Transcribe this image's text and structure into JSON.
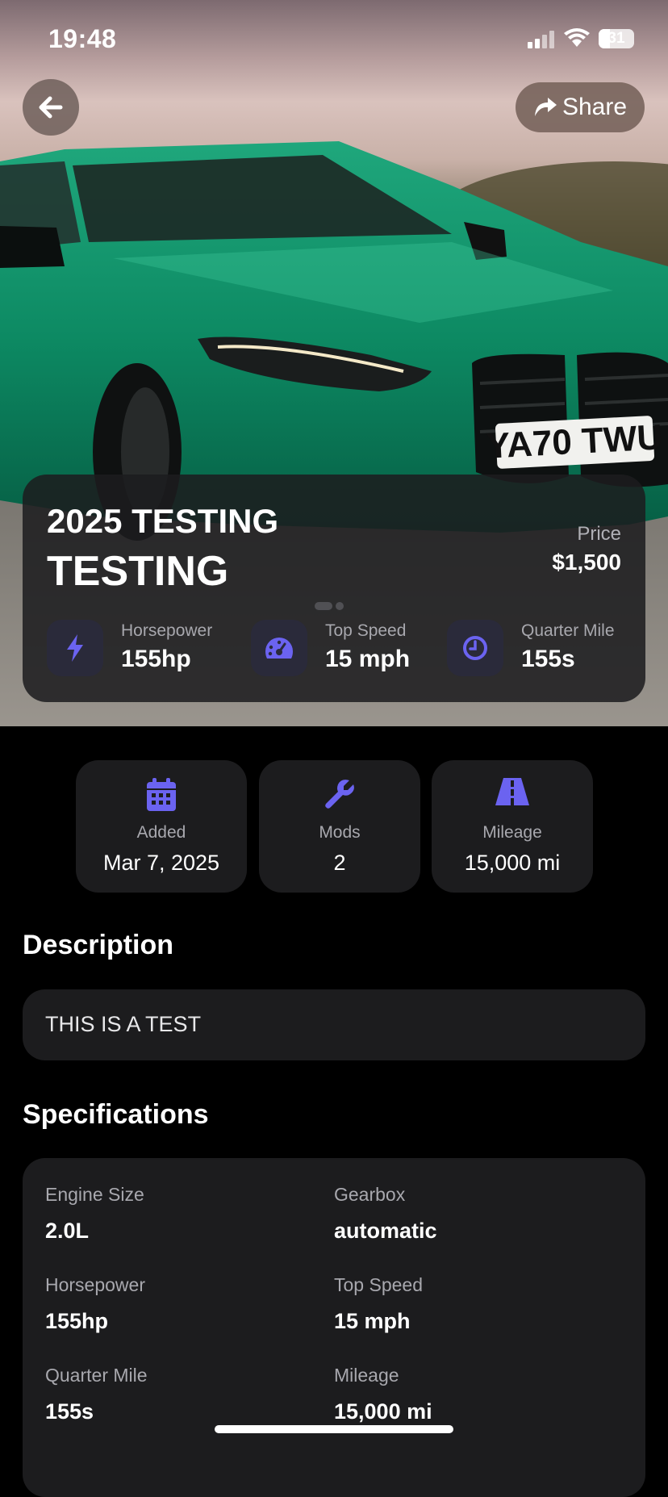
{
  "status_bar": {
    "time": "19:48",
    "battery": "31"
  },
  "header": {
    "share_label": "Share"
  },
  "car": {
    "year_title": "2025 TESTING",
    "model_title": "TESTING",
    "price_label": "Price",
    "price_value": "$1,500",
    "stats": [
      {
        "label": "Horsepower",
        "value": "155hp",
        "icon": "lightning-icon"
      },
      {
        "label": "Top Speed",
        "value": "15 mph",
        "icon": "speedometer-icon"
      },
      {
        "label": "Quarter Mile",
        "value": "155s",
        "icon": "clock-icon"
      }
    ]
  },
  "quick_stats": [
    {
      "label": "Added",
      "value": "Mar 7, 2025",
      "icon": "calendar-icon"
    },
    {
      "label": "Mods",
      "value": "2",
      "icon": "wrench-icon"
    },
    {
      "label": "Mileage",
      "value": "15,000 mi",
      "icon": "road-icon"
    }
  ],
  "description": {
    "title": "Description",
    "text": "THIS IS A TEST"
  },
  "specifications": {
    "title": "Specifications",
    "items": [
      {
        "label": "Engine Size",
        "value": "2.0L"
      },
      {
        "label": "Gearbox",
        "value": "automatic"
      },
      {
        "label": "Horsepower",
        "value": "155hp"
      },
      {
        "label": "Top Speed",
        "value": "15 mph"
      },
      {
        "label": "Quarter Mile",
        "value": "155s"
      },
      {
        "label": "Mileage",
        "value": "15,000 mi"
      }
    ]
  },
  "photo": {
    "plate_text": "YA70 TWU"
  },
  "colors": {
    "accent": "#6b63f0",
    "card": "#1c1c1e",
    "background": "#000000"
  }
}
